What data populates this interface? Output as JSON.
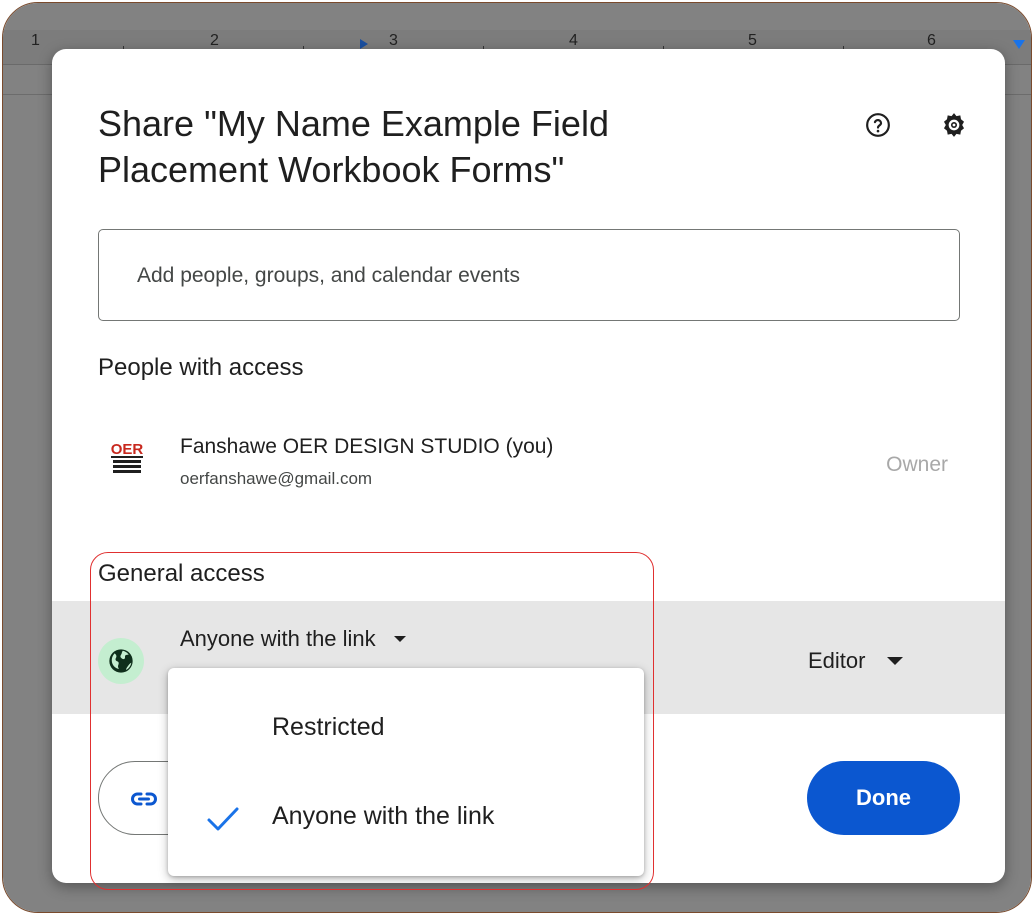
{
  "ruler": {
    "numbers": [
      "1",
      "2",
      "3",
      "4",
      "5",
      "6"
    ]
  },
  "dialog": {
    "title": "Share \"My Name Example Field Placement Workbook Forms\"",
    "help_icon": "help-circle-icon",
    "settings_icon": "gear-icon",
    "search_placeholder": "Add people, groups, and calendar events"
  },
  "people_with_access": {
    "heading": "People with access",
    "people": [
      {
        "logo_text": "OER",
        "name": "Fanshawe OER DESIGN STUDIO (you)",
        "email": "oerfanshawe@gmail.com",
        "role": "Owner"
      }
    ]
  },
  "general_access": {
    "heading": "General access",
    "icon": "globe-icon",
    "selected": "Anyone with the link",
    "role": "Editor",
    "options": [
      {
        "label": "Restricted",
        "checked": false
      },
      {
        "label": "Anyone with the link",
        "checked": true
      }
    ]
  },
  "footer": {
    "copy_link_icon": "link-icon",
    "done_label": "Done"
  },
  "colors": {
    "primary": "#0b57d0",
    "check": "#1a73e8",
    "globe_bg": "#c4eed0",
    "highlight_border": "#e03030"
  }
}
